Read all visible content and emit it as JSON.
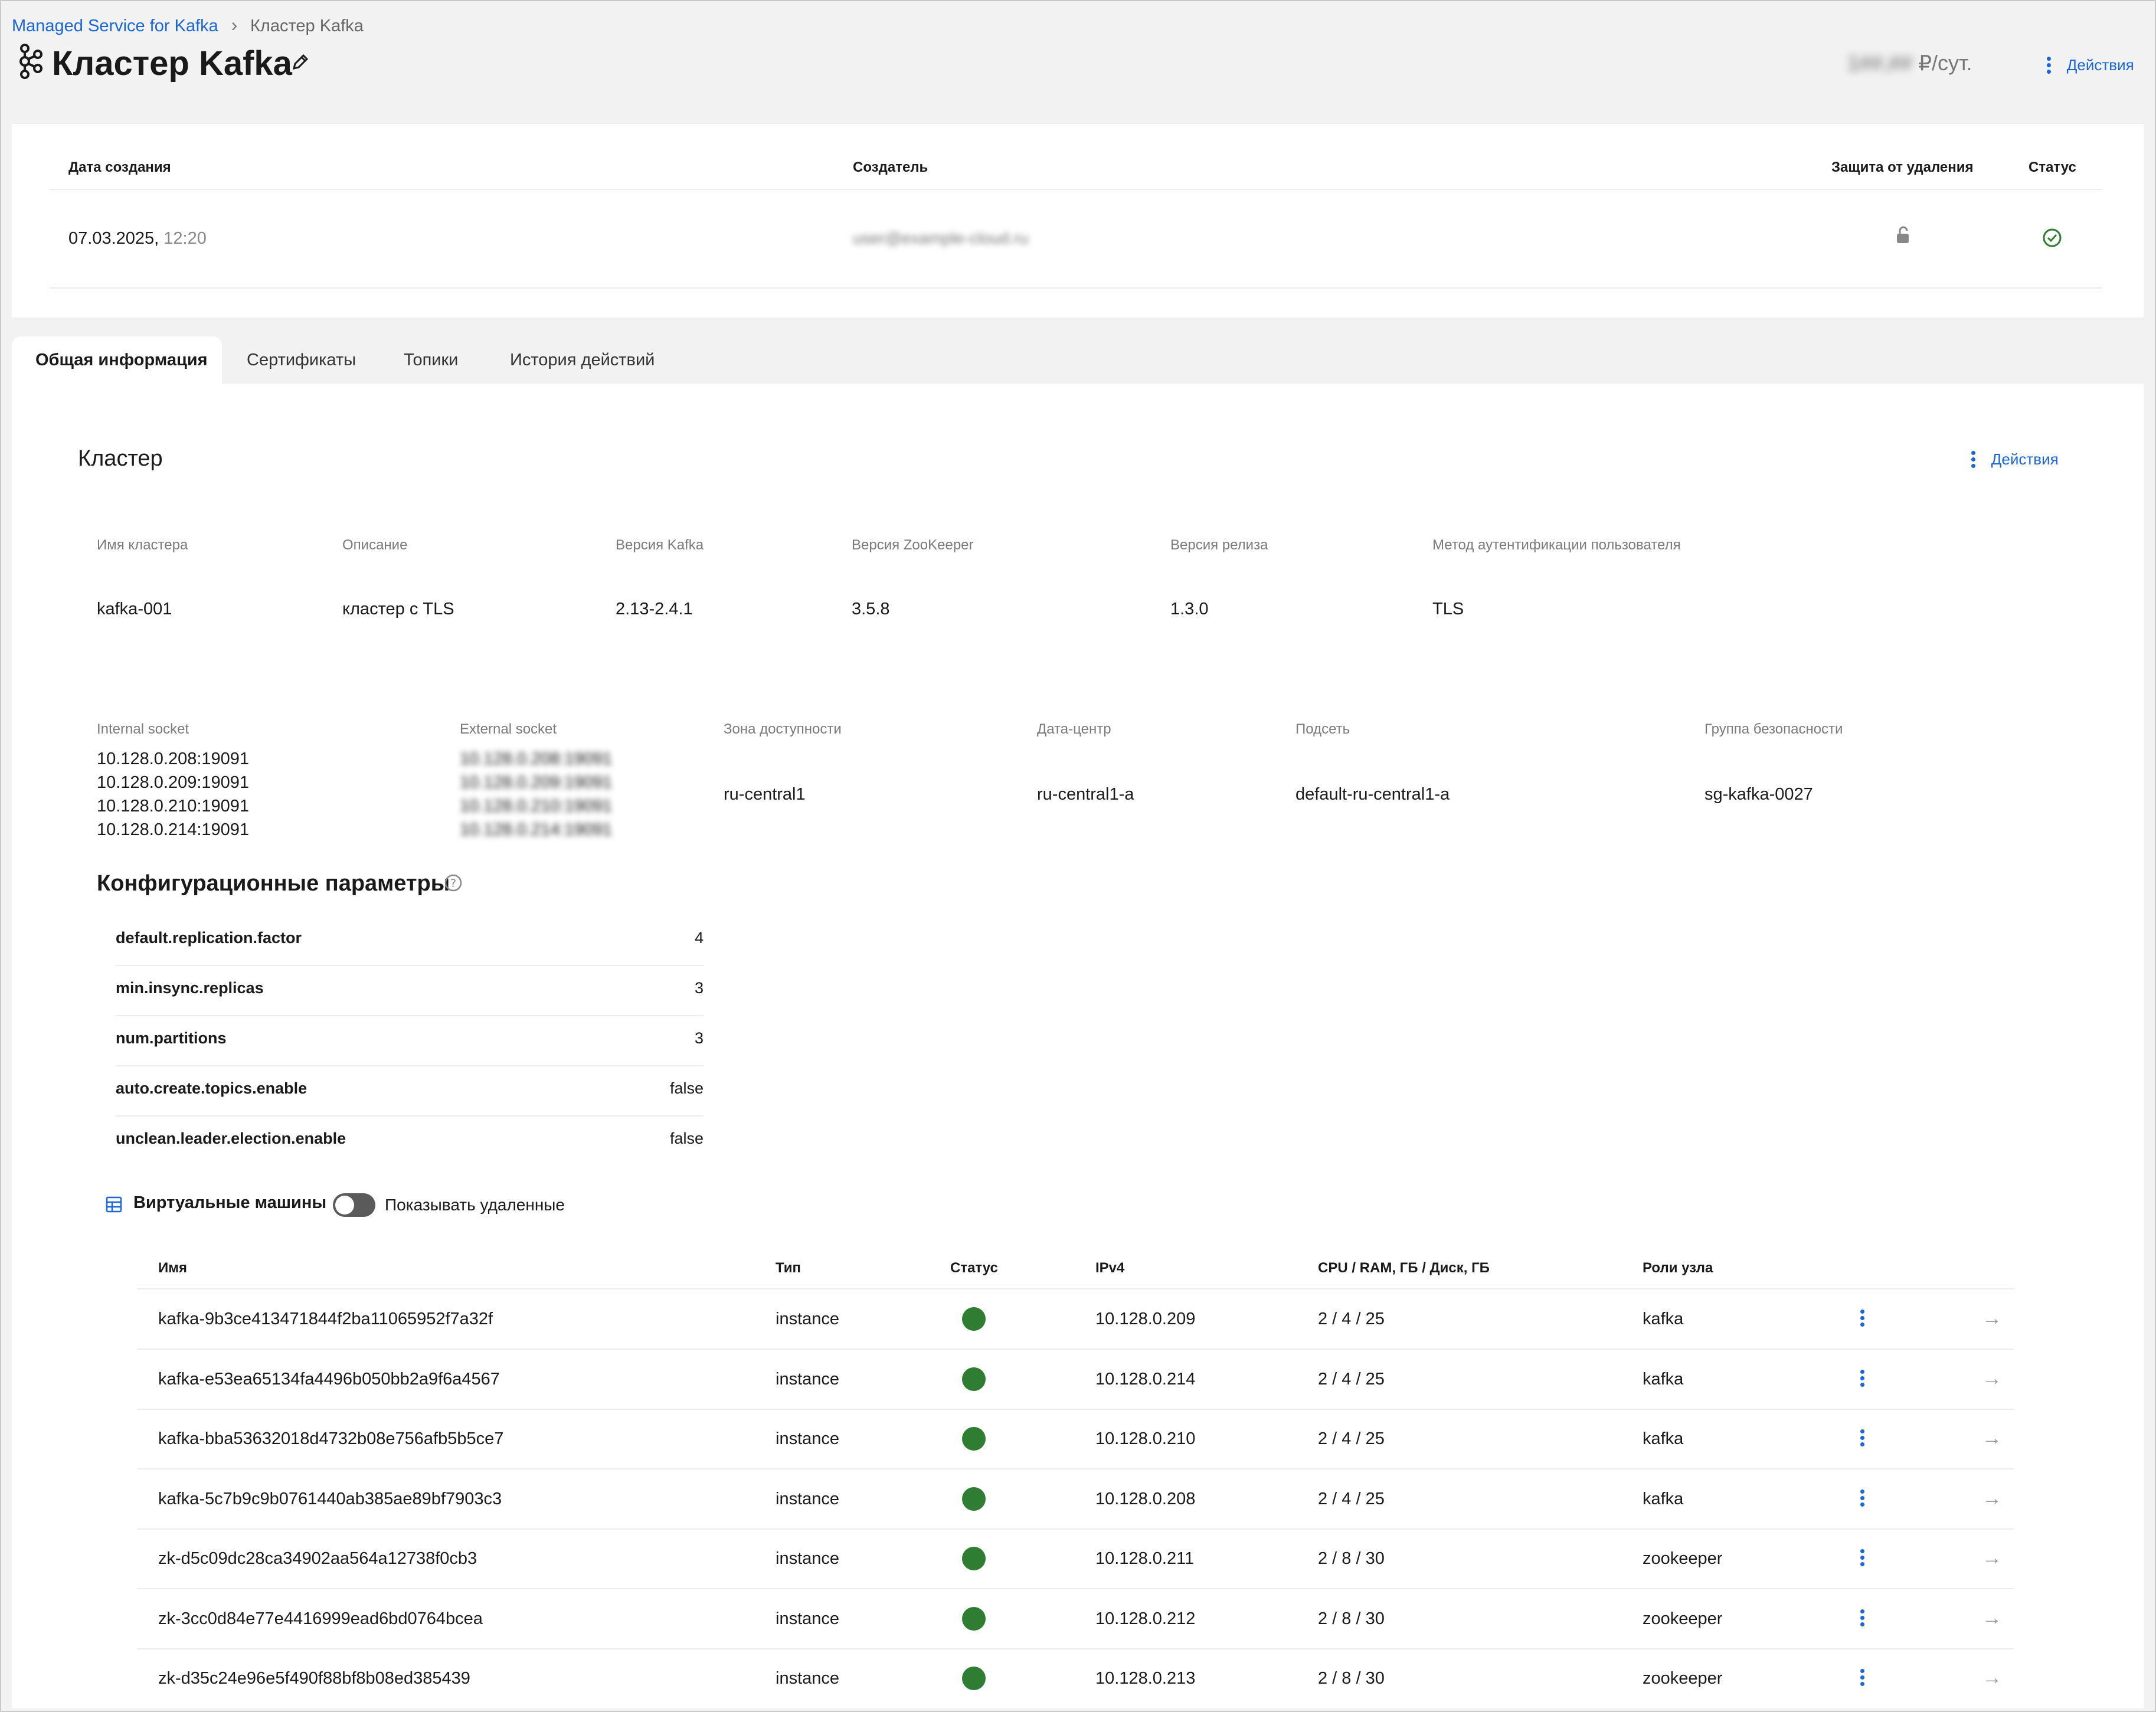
{
  "breadcrumb": {
    "parent": "Managed Service for Kafka",
    "current": "Кластер Kafka"
  },
  "header": {
    "title": "Кластер Kafka",
    "price_value": "1##,## ",
    "price_unit": "₽/сут.",
    "actions_label": "Действия"
  },
  "info": {
    "col_created": "Дата создания",
    "col_creator": "Создатель",
    "col_protection": "Защита от удаления",
    "col_status": "Статус",
    "created_date": "07.03.2025,",
    "created_time": "12:20",
    "creator": "user@example-cloud.ru"
  },
  "tabs": [
    {
      "label": "Общая информация",
      "active": true
    },
    {
      "label": "Сертификаты",
      "active": false
    },
    {
      "label": "Топики",
      "active": false
    },
    {
      "label": "История действий",
      "active": false
    }
  ],
  "cluster": {
    "section_title": "Кластер",
    "actions_label": "Действия",
    "labels": {
      "name": "Имя кластера",
      "description": "Описание",
      "kafka_version": "Версия Kafka",
      "zk_version": "Версия ZooKeeper",
      "release_version": "Версия релиза",
      "auth_method": "Метод аутентификации пользователя"
    },
    "values": {
      "name": "kafka-001",
      "description": "кластер с TLS",
      "kafka_version": "2.13-2.4.1",
      "zk_version": "3.5.8",
      "release_version": "1.3.0",
      "auth_method": "TLS"
    }
  },
  "network": {
    "labels": {
      "internal": "Internal socket",
      "external": "External socket",
      "zone": "Зона доступности",
      "datacenter": "Дата-центр",
      "subnet": "Подсеть",
      "security_group": "Группа безопасности"
    },
    "internal_sockets": [
      "10.128.0.208:19091",
      "10.128.0.209:19091",
      "10.128.0.210:19091",
      "10.128.0.214:19091"
    ],
    "external_sockets": [
      "10.128.0.208:19091",
      "10.128.0.209:19091",
      "10.128.0.210:19091",
      "10.128.0.214:19091"
    ],
    "zone": "ru-central1",
    "datacenter": "ru-central1-a",
    "subnet": "default-ru-central1-a",
    "security_group": "sg-kafka-0027"
  },
  "config": {
    "title": "Конфигурационные параметры",
    "params": [
      {
        "key": "default.replication.factor",
        "value": "4"
      },
      {
        "key": "min.insync.replicas",
        "value": "3"
      },
      {
        "key": "num.partitions",
        "value": "3"
      },
      {
        "key": "auto.create.topics.enable",
        "value": "false"
      },
      {
        "key": "unclean.leader.election.enable",
        "value": "false"
      }
    ]
  },
  "vms": {
    "title": "Виртуальные машины",
    "show_deleted_label": "Показывать удаленные",
    "show_deleted": false,
    "columns": [
      "Имя",
      "Тип",
      "Статус",
      "IPv4",
      "CPU / RAM, ГБ / Диск, ГБ",
      "Роли узла"
    ],
    "status_color": "#2e7d32",
    "rows": [
      {
        "name": "kafka-9b3ce413471844f2ba11065952f7a32f",
        "type": "instance",
        "ip": "10.128.0.209",
        "res": "2 / 4 / 25",
        "role": "kafka"
      },
      {
        "name": "kafka-e53ea65134fa4496b050bb2a9f6a4567",
        "type": "instance",
        "ip": "10.128.0.214",
        "res": "2 / 4 / 25",
        "role": "kafka"
      },
      {
        "name": "kafka-bba53632018d4732b08e756afb5b5ce7",
        "type": "instance",
        "ip": "10.128.0.210",
        "res": "2 / 4 / 25",
        "role": "kafka"
      },
      {
        "name": "kafka-5c7b9c9b0761440ab385ae89bf7903c3",
        "type": "instance",
        "ip": "10.128.0.208",
        "res": "2 / 4 / 25",
        "role": "kafka"
      },
      {
        "name": "zk-d5c09dc28ca34902aa564a12738f0cb3",
        "type": "instance",
        "ip": "10.128.0.211",
        "res": "2 / 8 / 30",
        "role": "zookeeper"
      },
      {
        "name": "zk-3cc0d84e77e4416999ead6bd0764bcea",
        "type": "instance",
        "ip": "10.128.0.212",
        "res": "2 / 8 / 30",
        "role": "zookeeper"
      },
      {
        "name": "zk-d35c24e96e5f490f88bf8b08ed385439",
        "type": "instance",
        "ip": "10.128.0.213",
        "res": "2 / 8 / 30",
        "role": "zookeeper"
      }
    ]
  }
}
